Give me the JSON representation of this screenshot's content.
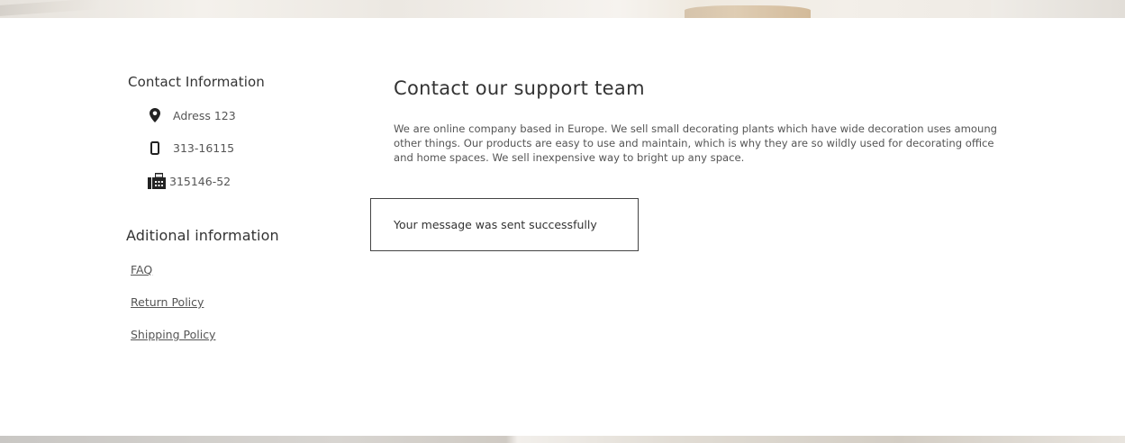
{
  "sidebar": {
    "contact_heading": "Contact Information",
    "contact": {
      "address": {
        "icon": "map-marker-icon",
        "text": "Adress 123"
      },
      "phone": {
        "icon": "mobile-phone-icon",
        "text": "313-16115"
      },
      "fax": {
        "icon": "fax-icon",
        "text": "315146-52"
      }
    },
    "additional_heading": "Aditional information",
    "links": [
      {
        "label": "FAQ"
      },
      {
        "label": "Return Policy"
      },
      {
        "label": "Shipping Policy"
      }
    ]
  },
  "main": {
    "title": "Contact our support team",
    "description": "We are online company based in Europe. We sell small decorating plants which have wide decoration uses amoung other things. Our products are easy to use and maintain, which is why they are so wildly used for decorating office and home spaces. We sell inexpensive way to bright up any space.",
    "success_message": "Your message was sent successfully"
  },
  "colors": {
    "text": "#333333",
    "muted_text": "#555555",
    "border": "#444444",
    "background": "#ffffff"
  }
}
